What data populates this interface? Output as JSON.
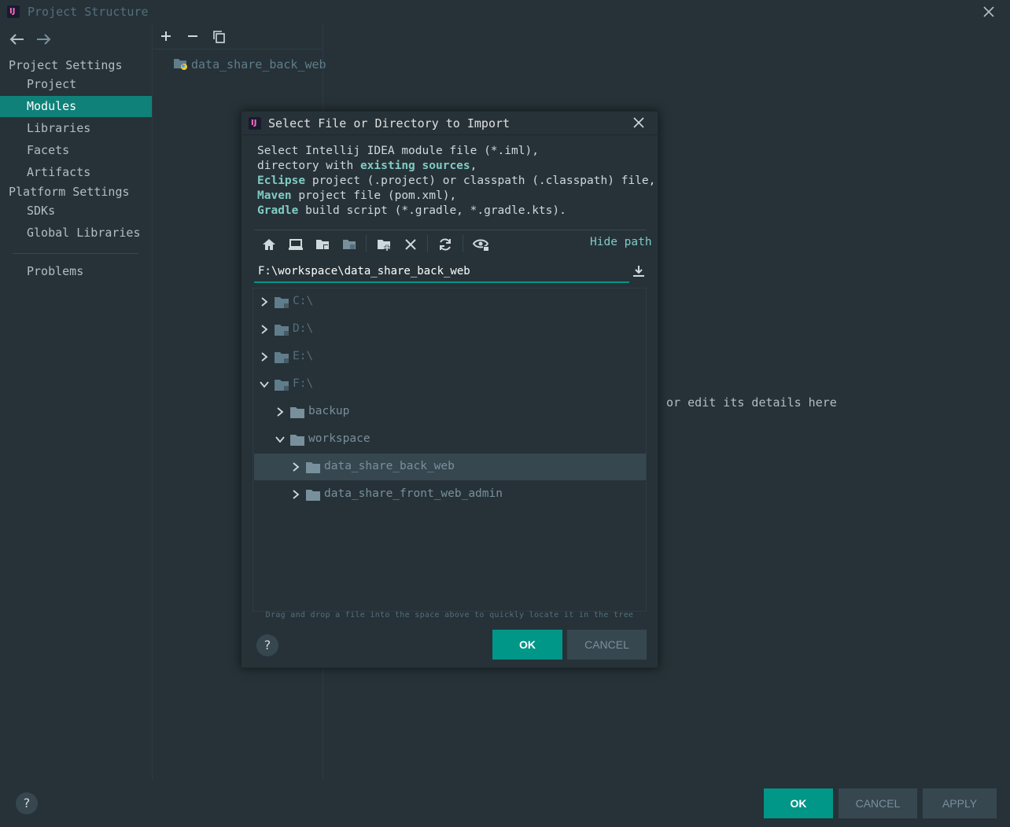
{
  "window": {
    "title": "Project Structure"
  },
  "sidebar": {
    "project_settings_header": "Project Settings",
    "project_items": [
      {
        "label": "Project"
      },
      {
        "label": "Modules",
        "selected": true
      },
      {
        "label": "Libraries"
      },
      {
        "label": "Facets"
      },
      {
        "label": "Artifacts"
      }
    ],
    "platform_settings_header": "Platform Settings",
    "platform_items": [
      {
        "label": "SDKs"
      },
      {
        "label": "Global Libraries"
      }
    ],
    "problems_label": "Problems"
  },
  "modules": {
    "items": [
      {
        "label": "data_share_back_web",
        "icon": "python-module-folder-icon"
      }
    ]
  },
  "detail": {
    "hint": "/ or edit its details here"
  },
  "footer": {
    "help": "?",
    "ok": "OK",
    "cancel": "CANCEL",
    "apply": "APPLY"
  },
  "dialog": {
    "title": "Select File or Directory to Import",
    "description": {
      "line1": "Select Intellij IDEA module file (*.iml),",
      "line2_pre": "directory with ",
      "line2_hl": "existing sources",
      "line2_post": ",",
      "line3_hl": "Eclipse",
      "line3_post": " project (.project) or classpath (.classpath) file,",
      "line4_hl": "Maven",
      "line4_post": " project file (pom.xml),",
      "line5_hl": "Gradle",
      "line5_post": " build script (*.gradle, *.gradle.kts)."
    },
    "hide_path": "Hide path",
    "path_value": "F:\\workspace\\data_share_back_web",
    "tree": [
      {
        "label": "C:\\",
        "depth": 0,
        "expanded": false,
        "kind": "drive"
      },
      {
        "label": "D:\\",
        "depth": 0,
        "expanded": false,
        "kind": "drive"
      },
      {
        "label": "E:\\",
        "depth": 0,
        "expanded": false,
        "kind": "drive"
      },
      {
        "label": "F:\\",
        "depth": 0,
        "expanded": true,
        "kind": "drive"
      },
      {
        "label": "backup",
        "depth": 1,
        "expanded": false,
        "kind": "dir"
      },
      {
        "label": "workspace",
        "depth": 1,
        "expanded": true,
        "kind": "dir"
      },
      {
        "label": "data_share_back_web",
        "depth": 2,
        "expanded": false,
        "kind": "dir",
        "selected": true
      },
      {
        "label": "data_share_front_web_admin",
        "depth": 2,
        "expanded": false,
        "kind": "dir"
      }
    ],
    "drag_hint": "Drag and drop a file into the space above to quickly locate it in the tree",
    "help": "?",
    "ok": "OK",
    "cancel": "CANCEL"
  },
  "colors": {
    "background": "#263238",
    "accent": "#009688",
    "selection": "#0f8179",
    "highlight_text": "#80cbc4"
  }
}
